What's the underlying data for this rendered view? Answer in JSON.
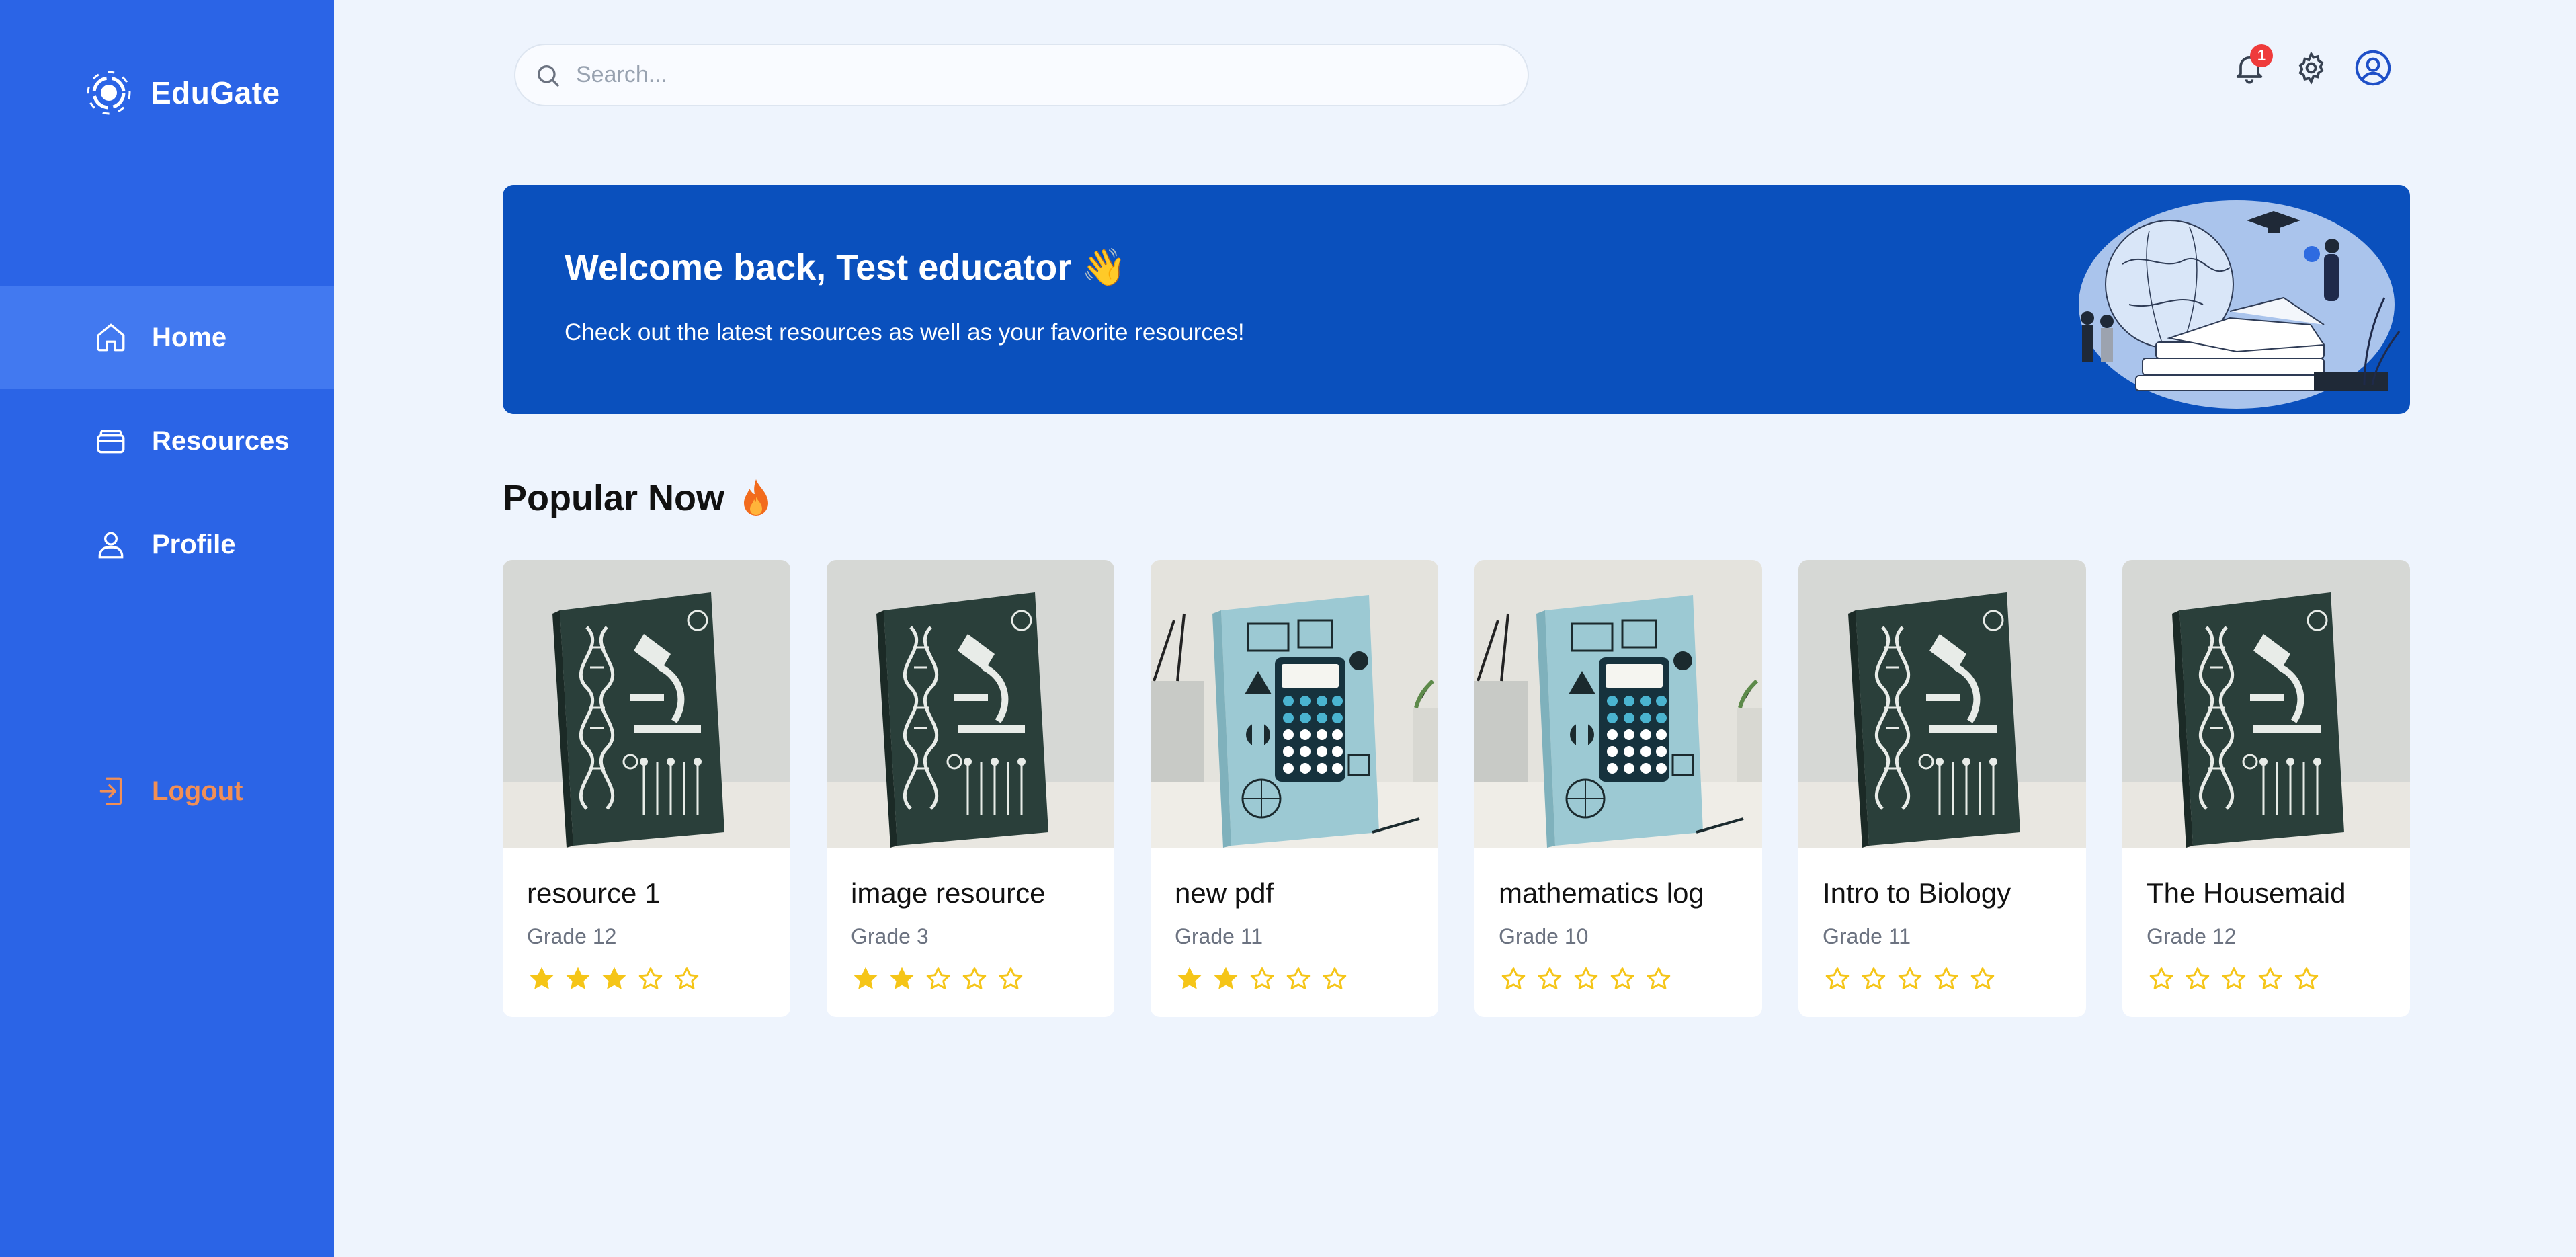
{
  "app": {
    "name": "EduGate",
    "accent": "#2b64e6",
    "banner_color": "#0a50bd",
    "logout_color": "#f28f55",
    "star_color": "#f5c518"
  },
  "sidebar": {
    "items": [
      {
        "label": "Home",
        "icon": "home-icon",
        "active": true
      },
      {
        "label": "Resources",
        "icon": "folder-icon",
        "active": false
      },
      {
        "label": "Profile",
        "icon": "user-icon",
        "active": false
      }
    ],
    "logout": {
      "label": "Logout",
      "icon": "logout-icon"
    }
  },
  "header": {
    "search": {
      "placeholder": "Search...",
      "value": ""
    },
    "notifications": {
      "count": "1",
      "icon": "bell-icon"
    },
    "settings_icon": "gear-icon",
    "avatar_icon": "user-circle-icon"
  },
  "banner": {
    "title": "Welcome back, Test educator",
    "emoji": "👋",
    "subtitle": "Check out the latest resources as well as your favorite resources!"
  },
  "popular": {
    "title": "Popular Now",
    "icon": "fire-icon",
    "cards": [
      {
        "title": "resource 1",
        "grade": "Grade 12",
        "rating": 3,
        "cover": "biology"
      },
      {
        "title": "image resource",
        "grade": "Grade 3",
        "rating": 2,
        "cover": "biology"
      },
      {
        "title": "new pdf",
        "grade": "Grade 11",
        "rating": 2,
        "cover": "mathematics"
      },
      {
        "title": "mathematics log",
        "grade": "Grade 10",
        "rating": 0,
        "cover": "mathematics"
      },
      {
        "title": "Intro to Biology",
        "grade": "Grade 11",
        "rating": 0,
        "cover": "biology"
      },
      {
        "title": "The Housemaid",
        "grade": "Grade 12",
        "rating": 0,
        "cover": "biology"
      }
    ]
  }
}
